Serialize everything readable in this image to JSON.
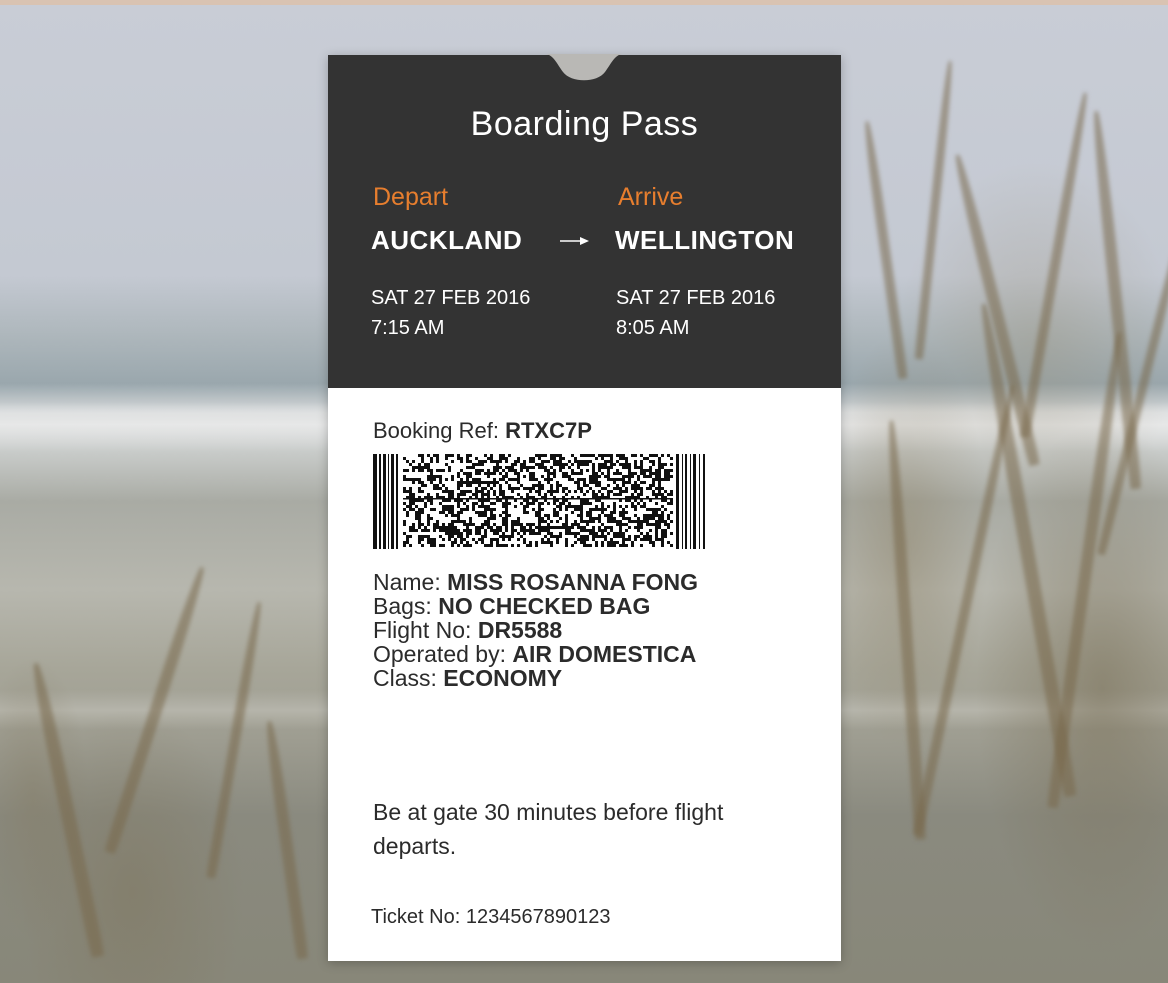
{
  "colors": {
    "header_bg": "#333333",
    "accent": "#e77e2e",
    "card_bg": "#ffffff",
    "text_dark": "#2b2b2b"
  },
  "icons": {
    "arrow": "right-arrow-icon",
    "barcode": "barcode-icon"
  },
  "pass": {
    "title": "Boarding Pass",
    "depart": {
      "label": "Depart",
      "city": "AUCKLAND",
      "date": "SAT 27 FEB 2016",
      "time": "7:15 AM"
    },
    "arrive": {
      "label": "Arrive",
      "city": "WELLINGTON",
      "date": "SAT 27 FEB 2016",
      "time": "8:05 AM"
    },
    "booking": {
      "label": "Booking Ref:",
      "value": "RTXC7P"
    },
    "details": [
      {
        "label": "Name:",
        "value": "MISS ROSANNA FONG"
      },
      {
        "label": "Bags:",
        "value": "NO CHECKED BAG"
      },
      {
        "label": "Flight No:",
        "value": "DR5588"
      },
      {
        "label": "Operated by:",
        "value": "AIR DOMESTICA"
      },
      {
        "label": "Class:",
        "value": "ECONOMY"
      }
    ],
    "note": "Be at gate 30 minutes before flight departs.",
    "ticket": {
      "label": "Ticket No:",
      "value": "1234567890123"
    }
  }
}
